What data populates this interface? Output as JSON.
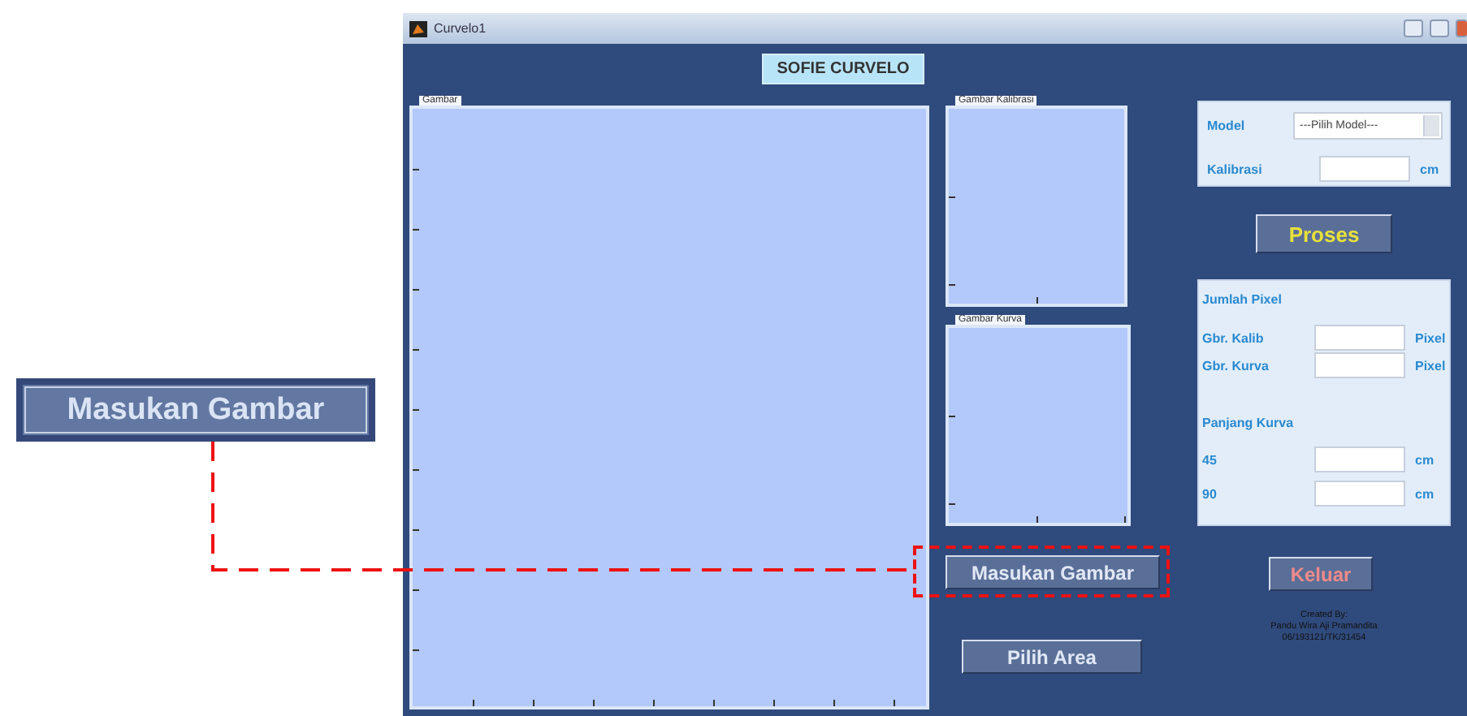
{
  "callout": {
    "label": "Masukan Gambar"
  },
  "window": {
    "title": "Curvelo1"
  },
  "heading": "SOFIE CURVELO",
  "axes": [
    {
      "label": "Gambar"
    },
    {
      "label": "Gambar Kalibrasi"
    },
    {
      "label": "Gambar Kurva"
    }
  ],
  "model_panel": {
    "model_label": "Model",
    "model_select": "---Pilih Model---",
    "kalibrasi_label": "Kalibrasi",
    "kalibrasi_unit": "cm"
  },
  "buttons": {
    "proses": "Proses",
    "masukan_gambar": "Masukan Gambar",
    "pilih_area": "Pilih Area",
    "keluar": "Keluar"
  },
  "results_panel": {
    "jumlah_title": "Jumlah Pixel",
    "jumlah_rows": [
      {
        "label": "Gbr. Kalib",
        "unit": "Pixel"
      },
      {
        "label": "Gbr. Kurva",
        "unit": "Pixel"
      }
    ],
    "panjang_title": "Panjang Kurva",
    "panjang_rows": [
      {
        "label": "45",
        "unit": "cm"
      },
      {
        "label": "90",
        "unit": "cm"
      }
    ]
  },
  "credits": [
    "Created By:",
    "Pandu Wira Aji Pramandita",
    "06/193121/TK/31454"
  ]
}
